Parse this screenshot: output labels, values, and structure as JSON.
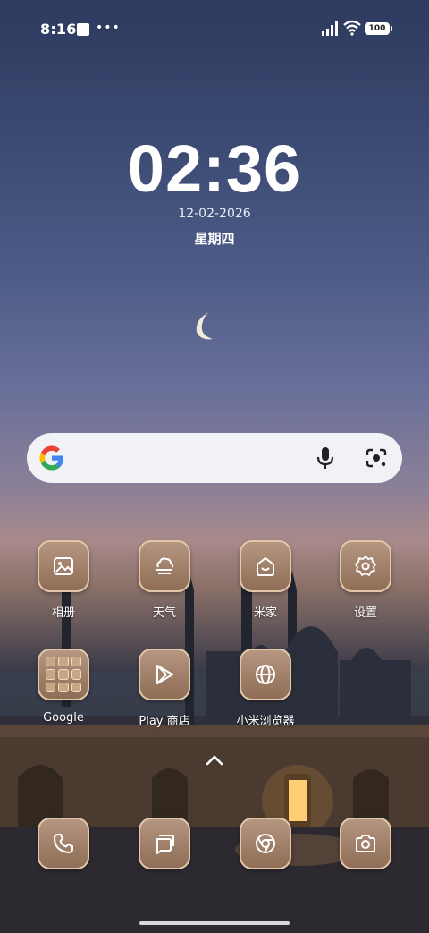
{
  "status_bar": {
    "time": "8:16",
    "battery": "100"
  },
  "lock": {
    "clock": "02:36",
    "date": "12-02-2026",
    "weekday": "星期四"
  },
  "apps_row1": [
    {
      "label": "相册",
      "icon": "gallery-icon"
    },
    {
      "label": "天气",
      "icon": "weather-icon"
    },
    {
      "label": "米家",
      "icon": "home-icon"
    },
    {
      "label": "设置",
      "icon": "gear-icon"
    }
  ],
  "apps_row2": [
    {
      "label": "Google",
      "icon": "folder-icon"
    },
    {
      "label": "Play 商店",
      "icon": "play-store-icon"
    },
    {
      "label": "小米浏览器",
      "icon": "browser-icon"
    }
  ],
  "dock": [
    {
      "icon": "phone-icon"
    },
    {
      "icon": "messages-icon"
    },
    {
      "icon": "chrome-icon"
    },
    {
      "icon": "camera-icon"
    }
  ],
  "colors": {
    "icon_bg": "#a68570",
    "icon_border": "#e2c7a9"
  }
}
